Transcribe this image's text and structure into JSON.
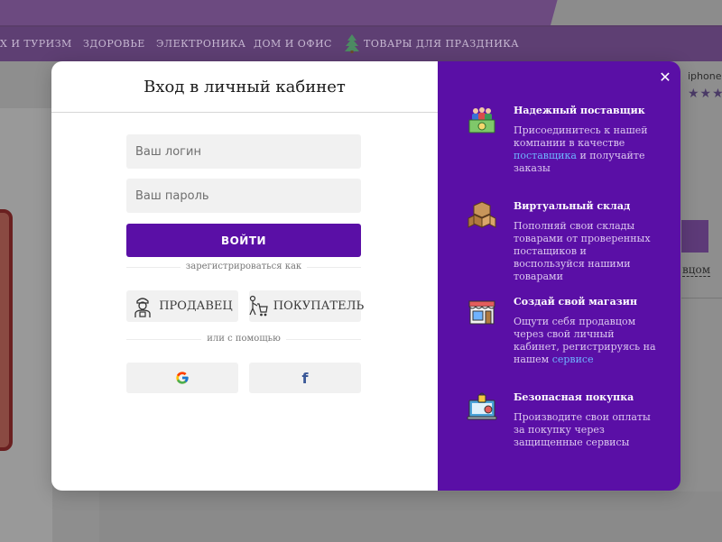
{
  "background": {
    "nav_items": [
      "Х И ТУРИЗМ",
      "ЗДОРОВЬЕ",
      "ЭЛЕКТРОНИКА",
      "ДОМ И ОФИС",
      "ТОВАРЫ ДЛЯ ПРАЗДНИКА"
    ],
    "product_text": "iphone",
    "stars": "★★★",
    "link_text": "вцом"
  },
  "login": {
    "title": "Вход в личный кабинет",
    "login_placeholder": "Ваш логин",
    "password_placeholder": "Ваш пароль",
    "submit_label": "ВОЙТИ",
    "register_as": "зарегистрироваться как",
    "seller_label": "ПРОДАВЕЦ",
    "buyer_label": "ПОКУПАТЕЛЬ",
    "or_with": "или с помощью"
  },
  "features": [
    {
      "title": "Надежный поставщик",
      "desc_before": "Присоединитесь к нашей компании в качестве ",
      "link": "поставщика",
      "desc_after": " и получайте заказы",
      "icon": "supplier-icon"
    },
    {
      "title": "Виртуальный склад",
      "desc": "Пополняй свои склады товарами от проверенных постащиков и воспользуйся нашими товарами",
      "icon": "warehouse-boxes-icon"
    },
    {
      "title": "Создай свой магазин",
      "desc_before": "Ощути себя продавцом через свой личный кабинет, регистрируясь на нашем ",
      "link": "сервисе",
      "desc_after": "",
      "icon": "shop-icon"
    },
    {
      "title": "Безопасная покупка",
      "desc": "Производите свои оплаты за покупку через защищенные сервисы",
      "icon": "secure-purchase-icon"
    }
  ],
  "colors": {
    "brand_purple": "#5a0fa6",
    "link_blue": "#6fb3ff",
    "facebook_blue": "#3b5998"
  }
}
